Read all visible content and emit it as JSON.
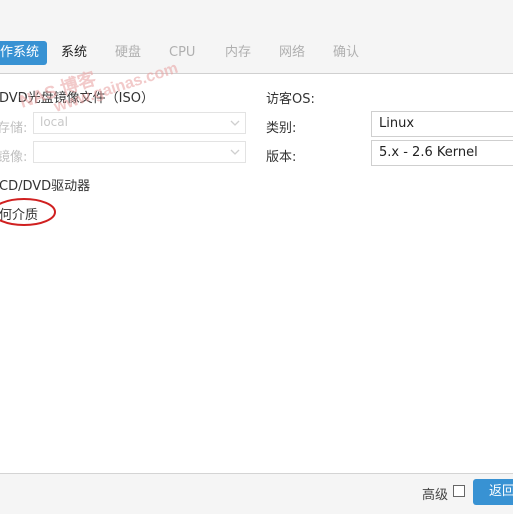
{
  "tabs": [
    {
      "label": "作系统",
      "state": "highlighted"
    },
    {
      "label": "系统",
      "state": "current"
    },
    {
      "label": "硬盘",
      "state": "disabled"
    },
    {
      "label": "CPU",
      "state": "disabled"
    },
    {
      "label": "内存",
      "state": "disabled"
    },
    {
      "label": "网络",
      "state": "disabled"
    },
    {
      "label": "确认",
      "state": "disabled"
    }
  ],
  "left": {
    "iso_option": "DVD光盘镜像文件（ISO）",
    "storage_label": "存储:",
    "storage_value": "local",
    "image_label": "镜像:",
    "image_value": "",
    "physical_option": "CD/DVD驱动器",
    "no_media_option": "何介质"
  },
  "right": {
    "guest_os_heading": "访客OS:",
    "type_label": "类别:",
    "type_value": "Linux",
    "version_label": "版本:",
    "version_value": "5.x - 2.6 Kernel"
  },
  "footer": {
    "advanced_label": "高级",
    "back_button": "返回"
  },
  "watermark": {
    "line1": "NAS 博客",
    "line2": "www.gainas.com"
  },
  "colors": {
    "accent": "#3892d3",
    "annotation": "#d02020"
  }
}
